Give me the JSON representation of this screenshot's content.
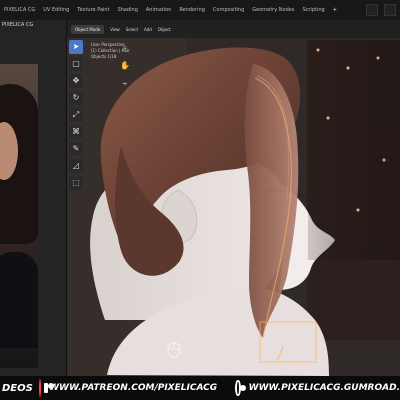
{
  "workspace_tabs": [
    "PIXELICA CG",
    "UV Editing",
    "Texture Paint",
    "Shading",
    "Animation",
    "Rendering",
    "Compositing",
    "Geometry Nodes",
    "Scripting",
    "+"
  ],
  "left_panel": {
    "status_line": "PIXELICA CG"
  },
  "viewport": {
    "header_items": [
      "Object Mode",
      "View",
      "Select",
      "Add",
      "Object"
    ],
    "info_lines": [
      "User Perspective",
      "(1) Collection | Hair",
      "Objects 1/18"
    ]
  },
  "toolbar_icons": [
    "cursor-icon",
    "select-box-icon",
    "move-icon",
    "rotate-icon",
    "scale-icon",
    "transform-icon",
    "annotate-icon",
    "measure-icon",
    "add-cube-icon"
  ],
  "side_icons": [
    "zoom-icon",
    "hand-icon",
    "camera-icon"
  ],
  "footer": {
    "left_fragment": "DEOS",
    "patreon_url": "WWW.PATREON.COM/PIXELICACG",
    "gumroad_url": "WWW.PIXELICACG.GUMROAD."
  },
  "colors": {
    "patreon_red": "#ff424d",
    "active_tool_blue": "#4b79c8"
  }
}
